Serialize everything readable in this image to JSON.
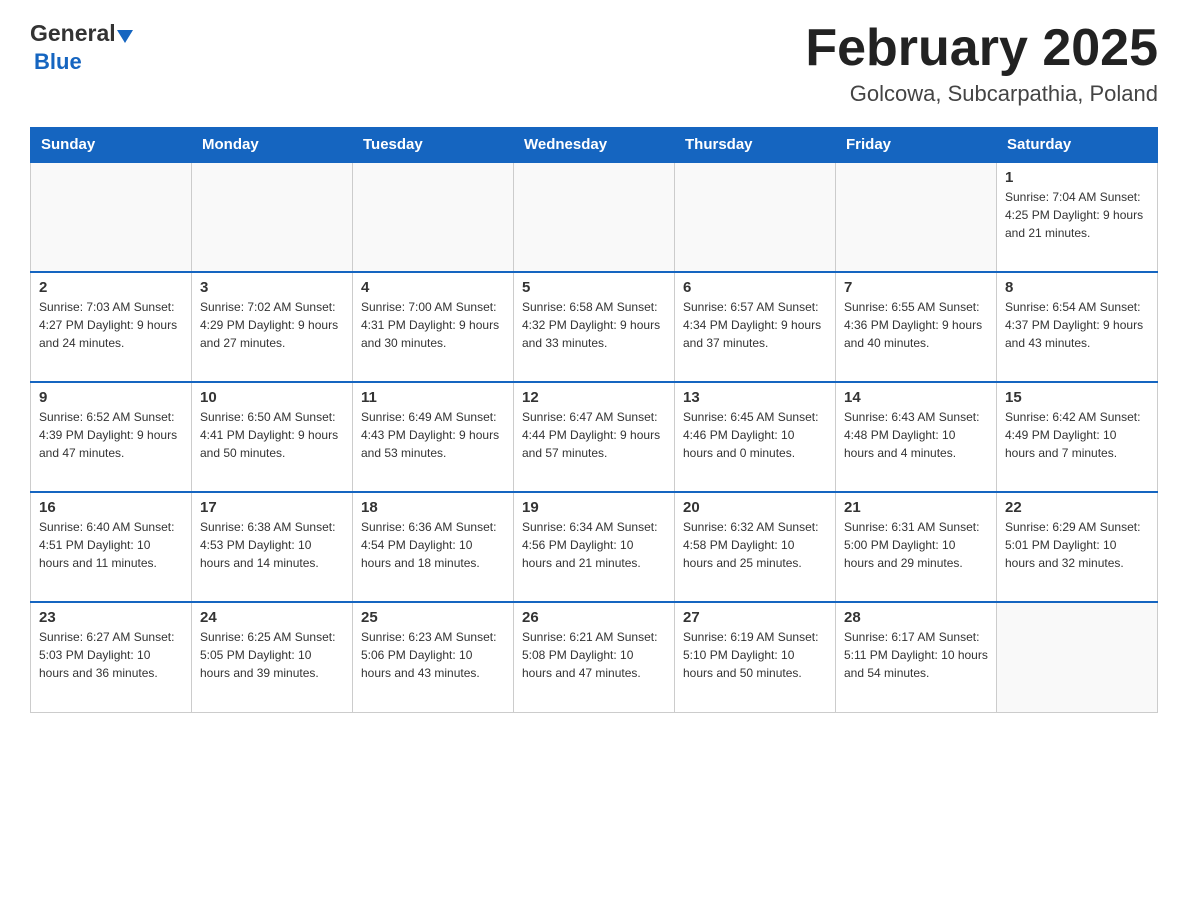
{
  "header": {
    "title": "February 2025",
    "subtitle": "Golcowa, Subcarpathia, Poland",
    "logo_general": "General",
    "logo_blue": "Blue"
  },
  "weekdays": [
    "Sunday",
    "Monday",
    "Tuesday",
    "Wednesday",
    "Thursday",
    "Friday",
    "Saturday"
  ],
  "weeks": [
    [
      {
        "day": "",
        "info": ""
      },
      {
        "day": "",
        "info": ""
      },
      {
        "day": "",
        "info": ""
      },
      {
        "day": "",
        "info": ""
      },
      {
        "day": "",
        "info": ""
      },
      {
        "day": "",
        "info": ""
      },
      {
        "day": "1",
        "info": "Sunrise: 7:04 AM\nSunset: 4:25 PM\nDaylight: 9 hours\nand 21 minutes."
      }
    ],
    [
      {
        "day": "2",
        "info": "Sunrise: 7:03 AM\nSunset: 4:27 PM\nDaylight: 9 hours\nand 24 minutes."
      },
      {
        "day": "3",
        "info": "Sunrise: 7:02 AM\nSunset: 4:29 PM\nDaylight: 9 hours\nand 27 minutes."
      },
      {
        "day": "4",
        "info": "Sunrise: 7:00 AM\nSunset: 4:31 PM\nDaylight: 9 hours\nand 30 minutes."
      },
      {
        "day": "5",
        "info": "Sunrise: 6:58 AM\nSunset: 4:32 PM\nDaylight: 9 hours\nand 33 minutes."
      },
      {
        "day": "6",
        "info": "Sunrise: 6:57 AM\nSunset: 4:34 PM\nDaylight: 9 hours\nand 37 minutes."
      },
      {
        "day": "7",
        "info": "Sunrise: 6:55 AM\nSunset: 4:36 PM\nDaylight: 9 hours\nand 40 minutes."
      },
      {
        "day": "8",
        "info": "Sunrise: 6:54 AM\nSunset: 4:37 PM\nDaylight: 9 hours\nand 43 minutes."
      }
    ],
    [
      {
        "day": "9",
        "info": "Sunrise: 6:52 AM\nSunset: 4:39 PM\nDaylight: 9 hours\nand 47 minutes."
      },
      {
        "day": "10",
        "info": "Sunrise: 6:50 AM\nSunset: 4:41 PM\nDaylight: 9 hours\nand 50 minutes."
      },
      {
        "day": "11",
        "info": "Sunrise: 6:49 AM\nSunset: 4:43 PM\nDaylight: 9 hours\nand 53 minutes."
      },
      {
        "day": "12",
        "info": "Sunrise: 6:47 AM\nSunset: 4:44 PM\nDaylight: 9 hours\nand 57 minutes."
      },
      {
        "day": "13",
        "info": "Sunrise: 6:45 AM\nSunset: 4:46 PM\nDaylight: 10 hours\nand 0 minutes."
      },
      {
        "day": "14",
        "info": "Sunrise: 6:43 AM\nSunset: 4:48 PM\nDaylight: 10 hours\nand 4 minutes."
      },
      {
        "day": "15",
        "info": "Sunrise: 6:42 AM\nSunset: 4:49 PM\nDaylight: 10 hours\nand 7 minutes."
      }
    ],
    [
      {
        "day": "16",
        "info": "Sunrise: 6:40 AM\nSunset: 4:51 PM\nDaylight: 10 hours\nand 11 minutes."
      },
      {
        "day": "17",
        "info": "Sunrise: 6:38 AM\nSunset: 4:53 PM\nDaylight: 10 hours\nand 14 minutes."
      },
      {
        "day": "18",
        "info": "Sunrise: 6:36 AM\nSunset: 4:54 PM\nDaylight: 10 hours\nand 18 minutes."
      },
      {
        "day": "19",
        "info": "Sunrise: 6:34 AM\nSunset: 4:56 PM\nDaylight: 10 hours\nand 21 minutes."
      },
      {
        "day": "20",
        "info": "Sunrise: 6:32 AM\nSunset: 4:58 PM\nDaylight: 10 hours\nand 25 minutes."
      },
      {
        "day": "21",
        "info": "Sunrise: 6:31 AM\nSunset: 5:00 PM\nDaylight: 10 hours\nand 29 minutes."
      },
      {
        "day": "22",
        "info": "Sunrise: 6:29 AM\nSunset: 5:01 PM\nDaylight: 10 hours\nand 32 minutes."
      }
    ],
    [
      {
        "day": "23",
        "info": "Sunrise: 6:27 AM\nSunset: 5:03 PM\nDaylight: 10 hours\nand 36 minutes."
      },
      {
        "day": "24",
        "info": "Sunrise: 6:25 AM\nSunset: 5:05 PM\nDaylight: 10 hours\nand 39 minutes."
      },
      {
        "day": "25",
        "info": "Sunrise: 6:23 AM\nSunset: 5:06 PM\nDaylight: 10 hours\nand 43 minutes."
      },
      {
        "day": "26",
        "info": "Sunrise: 6:21 AM\nSunset: 5:08 PM\nDaylight: 10 hours\nand 47 minutes."
      },
      {
        "day": "27",
        "info": "Sunrise: 6:19 AM\nSunset: 5:10 PM\nDaylight: 10 hours\nand 50 minutes."
      },
      {
        "day": "28",
        "info": "Sunrise: 6:17 AM\nSunset: 5:11 PM\nDaylight: 10 hours\nand 54 minutes."
      },
      {
        "day": "",
        "info": ""
      }
    ]
  ]
}
